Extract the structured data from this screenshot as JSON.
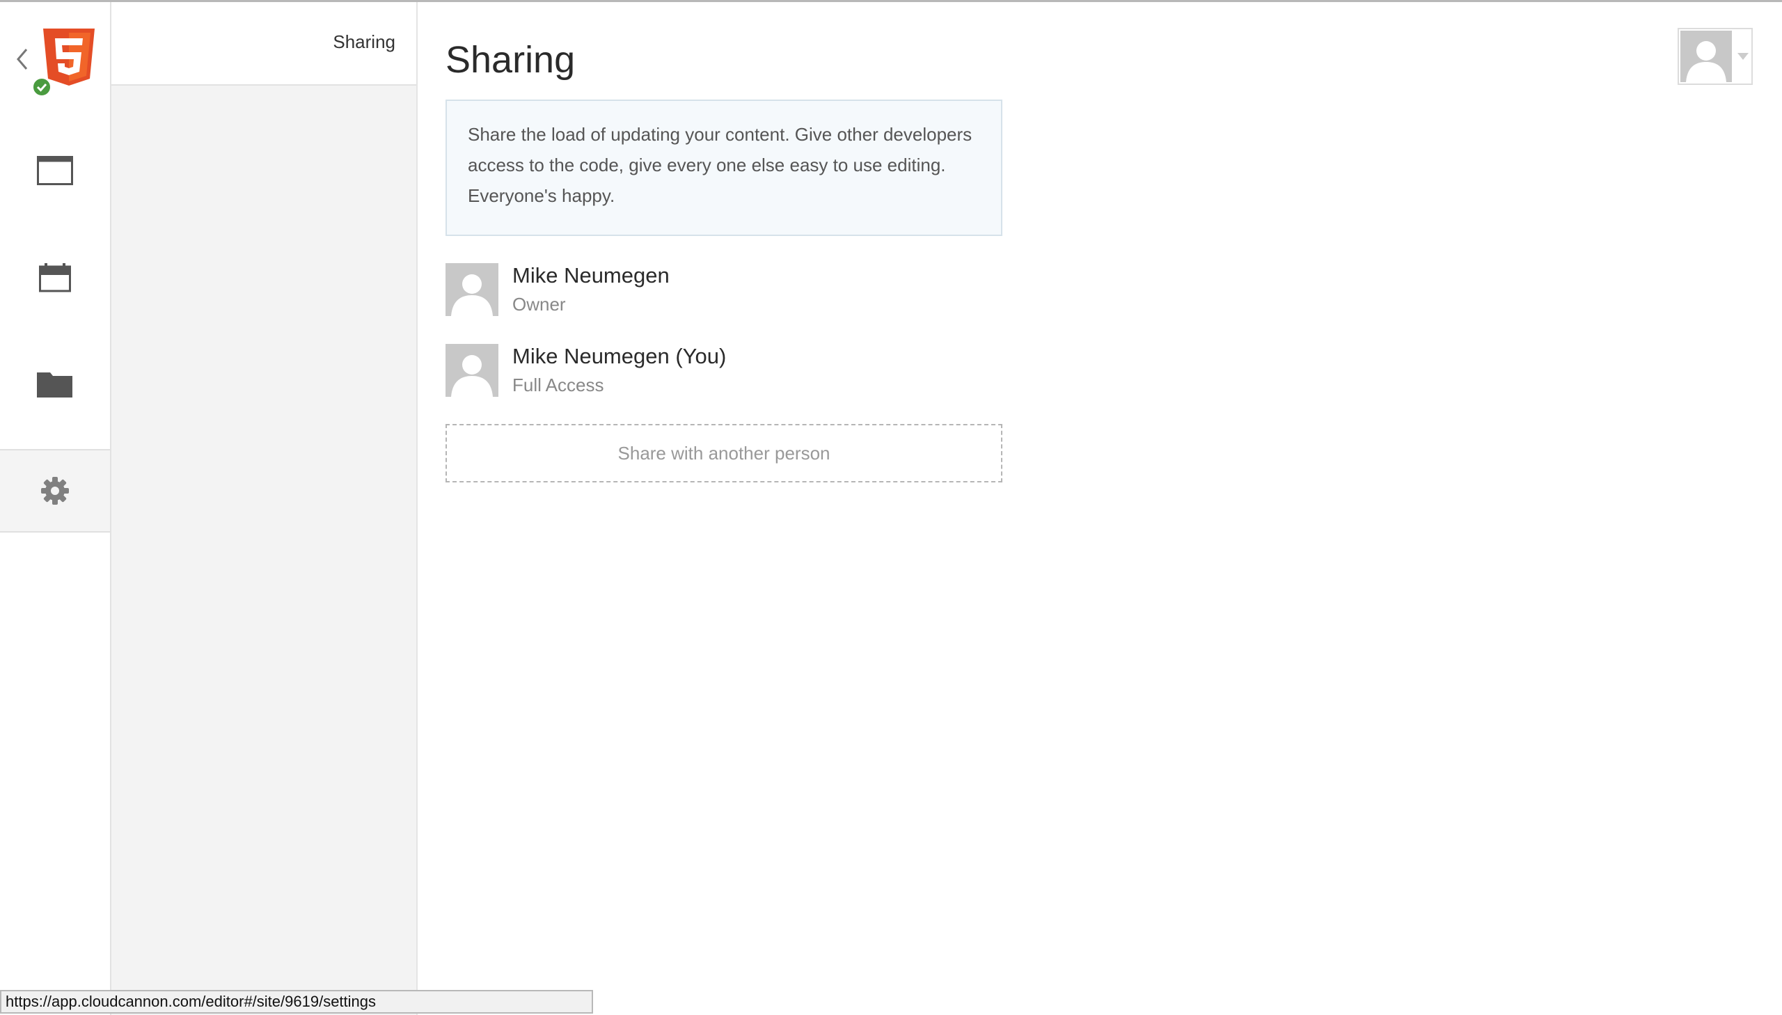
{
  "subnav": {
    "items": [
      {
        "label": "Sharing"
      }
    ]
  },
  "main": {
    "title": "Sharing",
    "info_text": "Share the load of updating your content. Give other developers access to the code, give every one else easy to use editing. Everyone's happy.",
    "members": [
      {
        "name": "Mike Neumegen",
        "role": "Owner"
      },
      {
        "name": "Mike Neumegen (You)",
        "role": "Full Access"
      }
    ],
    "share_button": "Share with another person"
  },
  "status_bar": {
    "url": "https://app.cloudcannon.com/editor#/site/9619/settings"
  },
  "icons": {
    "back": "chevron-left-icon",
    "logo": "html5-logo",
    "status": "check-circle-icon",
    "rail": [
      "browser-window-icon",
      "calendar-icon",
      "folder-icon",
      "gear-icon"
    ],
    "user": "avatar-icon",
    "caret": "caret-down-icon"
  },
  "colors": {
    "html5_orange": "#e44d26",
    "html5_orange_light": "#f16529",
    "status_green": "#4a9b3f",
    "info_bg": "#f5f9fc",
    "icon_gray": "#555555"
  }
}
